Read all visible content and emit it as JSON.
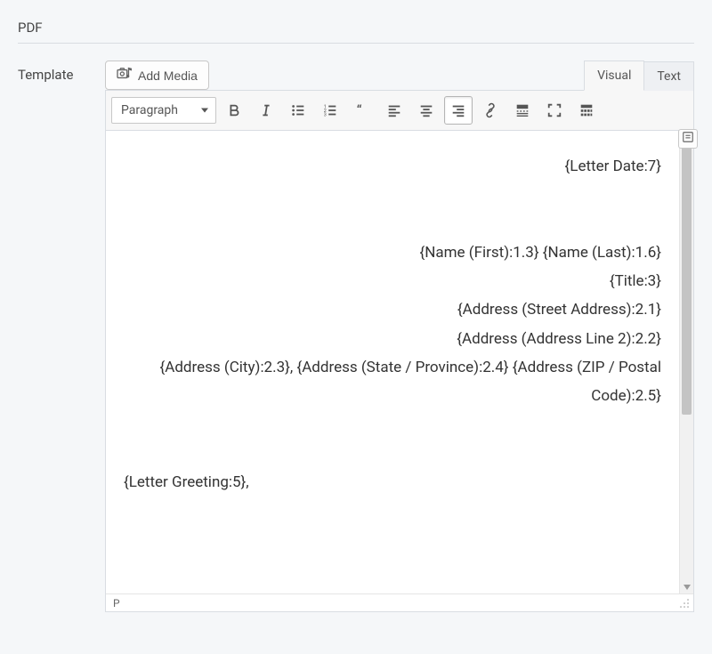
{
  "section_title": "PDF",
  "row_label": "Template",
  "add_media_label": "Add Media",
  "tabs": {
    "visual": "Visual",
    "text": "Text"
  },
  "format_dropdown": "Paragraph",
  "status_path": "P",
  "content": {
    "line_date": "{Letter Date:7}",
    "line_name": "{Name (First):1.3} {Name (Last):1.6}",
    "line_title": "{Title:3}",
    "line_street": "{Address (Street Address):2.1}",
    "line_addr2": "{Address (Address Line 2):2.2}",
    "line_citystate": "{Address (City):2.3}, {Address (State / Province):2.4} {Address (ZIP / Postal Code):2.5}",
    "line_greeting": "{Letter Greeting:5},"
  },
  "icons": {
    "add_media": "camera-music-icon",
    "bold": "bold-icon",
    "italic": "italic-icon",
    "ul": "bullet-list-icon",
    "ol": "numbered-list-icon",
    "quote": "blockquote-icon",
    "align_left": "align-left-icon",
    "align_center": "align-center-icon",
    "align_right": "align-right-icon",
    "link": "link-icon",
    "readmore": "insert-more-icon",
    "fullscreen": "fullscreen-icon",
    "kitchen_sink": "toolbar-toggle-icon",
    "side_toggle": "merge-tags-icon"
  }
}
